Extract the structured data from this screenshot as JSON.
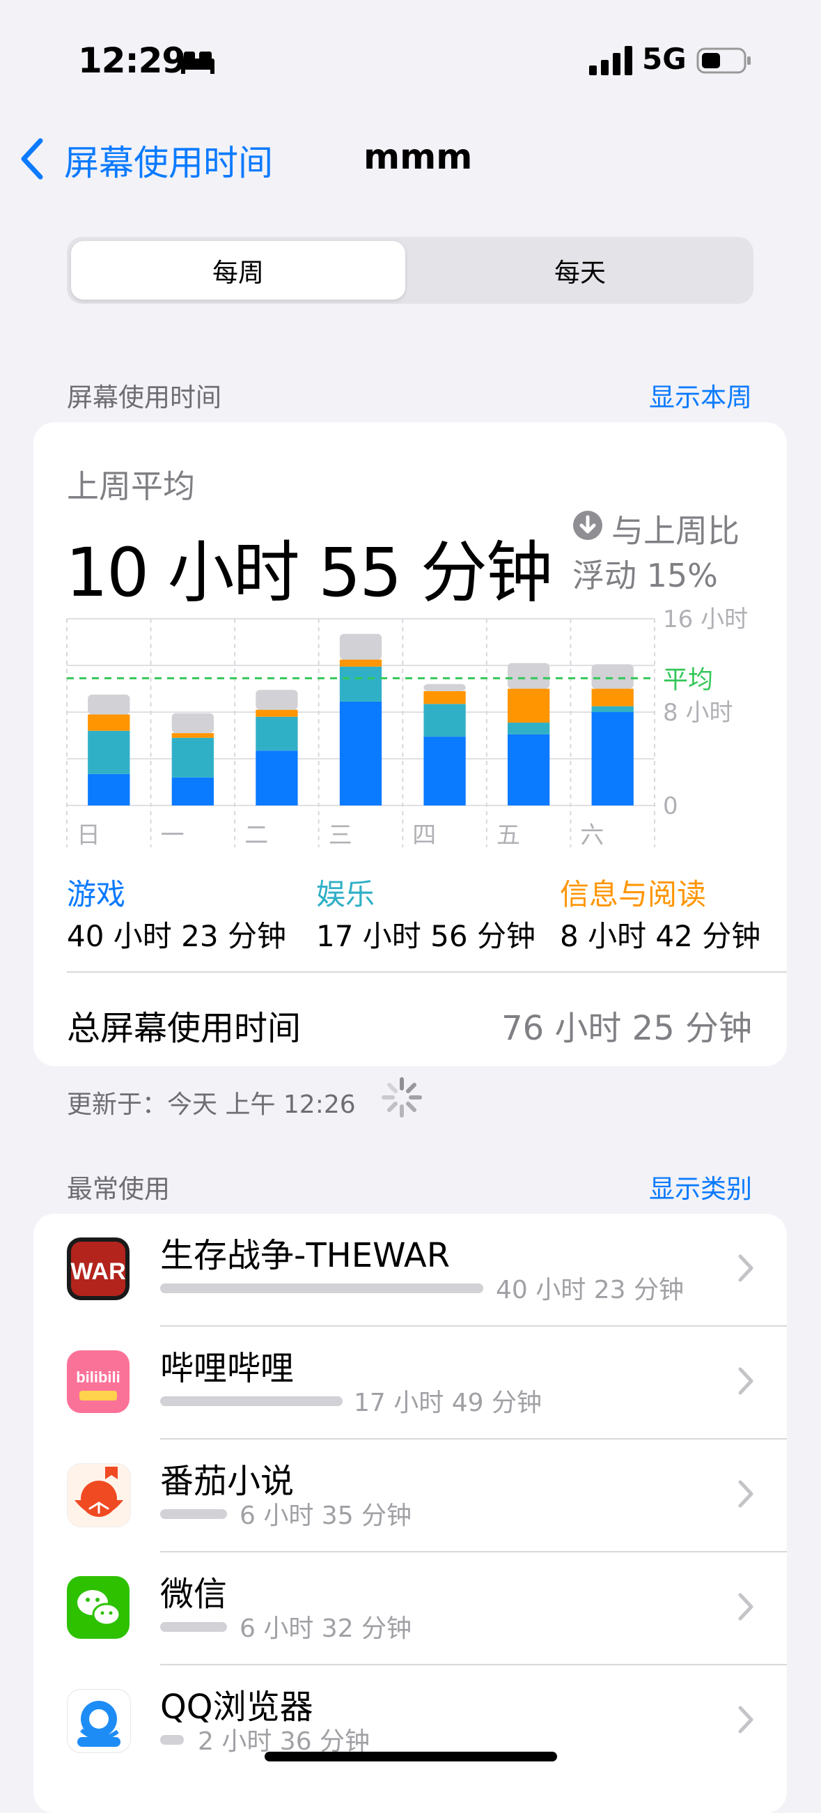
{
  "status_bar": {
    "time": "12:29",
    "network": "5G"
  },
  "nav": {
    "back_label": "屏幕使用时间",
    "title": "mmm"
  },
  "segmented": {
    "selected": "每周",
    "other": "每天"
  },
  "screen_time_section": {
    "header": "屏幕使用时间",
    "link": "显示本周"
  },
  "summary": {
    "caption": "上周平均",
    "value": "10 小时 55 分钟",
    "compare_line1": "与上周比",
    "compare_line2": "浮动 15%",
    "total_label": "总屏幕使用时间",
    "total_value": "76 小时 25 分钟"
  },
  "chart_data": {
    "type": "bar",
    "stacked": true,
    "categories": [
      "日",
      "一",
      "二",
      "三",
      "四",
      "五",
      "六"
    ],
    "y_tick_labels": [
      "16 小时",
      "8 小时",
      "0"
    ],
    "ylim": [
      0,
      16
    ],
    "average_label": "平均",
    "average_value": 10.9,
    "series": [
      {
        "name": "游戏",
        "color": "#0a7aff",
        "values": [
          2.7,
          2.4,
          4.7,
          8.9,
          5.9,
          6.1,
          8.0
        ]
      },
      {
        "name": "娱乐",
        "color": "#30b0c7",
        "values": [
          3.7,
          3.4,
          2.9,
          3.0,
          2.8,
          1.0,
          0.5
        ]
      },
      {
        "name": "信息与阅读",
        "color": "#ff9500",
        "values": [
          1.4,
          0.4,
          0.6,
          0.6,
          1.1,
          2.9,
          1.5
        ]
      },
      {
        "name": "",
        "color": "#d1d1d6",
        "values": [
          1.7,
          1.7,
          1.7,
          2.2,
          0.6,
          2.2,
          2.1
        ]
      }
    ]
  },
  "legend": [
    {
      "name": "游戏",
      "value": "40 小时 23 分钟",
      "color": "#0a7aff"
    },
    {
      "name": "娱乐",
      "value": "17 小时 56 分钟",
      "color": "#30b0c7"
    },
    {
      "name": "信息与阅读",
      "value": "8 小时 42 分钟",
      "color": "#ff9500"
    }
  ],
  "updated": {
    "text": "更新于：今天 上午 12:26"
  },
  "most_used": {
    "header": "最常使用",
    "link": "显示类别",
    "apps": [
      {
        "name": "生存战争-THEWAR",
        "usage": "40 小时 23 分钟",
        "fraction": 1.0,
        "icon": "war-game-icon"
      },
      {
        "name": "哔哩哔哩",
        "usage": "17 小时 49 分钟",
        "fraction": 0.44,
        "icon": "bilibili-icon"
      },
      {
        "name": "番茄小说",
        "usage": "6 小时 35 分钟",
        "fraction": 0.17,
        "icon": "fanqie-novel-icon"
      },
      {
        "name": "微信",
        "usage": "6 小时 32 分钟",
        "fraction": 0.17,
        "icon": "wechat-icon"
      },
      {
        "name": "QQ浏览器",
        "usage": "2 小时 36 分钟",
        "fraction": 0.07,
        "icon": "qq-browser-icon"
      }
    ]
  },
  "colors": {
    "accent": "#0a7aff",
    "average_line": "#34c759"
  }
}
